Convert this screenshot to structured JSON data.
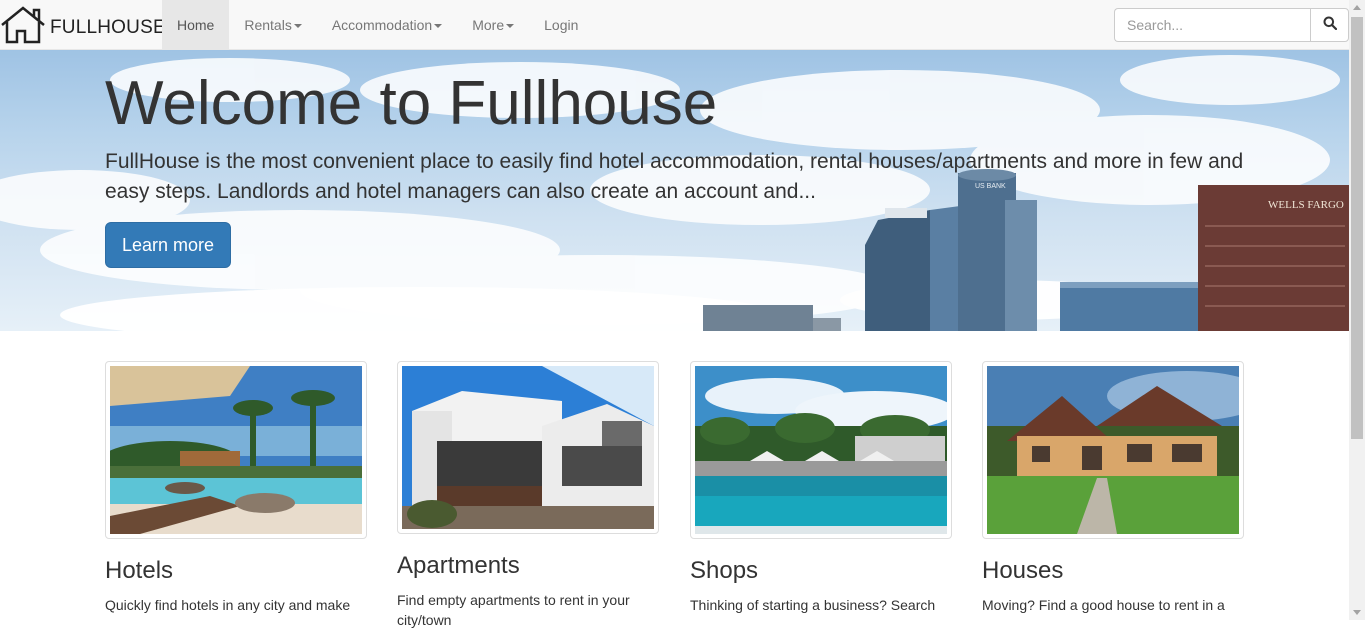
{
  "brand": {
    "name": "FULLHOUSE",
    "icon": "house-outline-icon"
  },
  "nav": {
    "items": [
      {
        "label": "Home",
        "active": true,
        "dropdown": false
      },
      {
        "label": "Rentals",
        "active": false,
        "dropdown": true
      },
      {
        "label": "Accommodation",
        "active": false,
        "dropdown": true
      },
      {
        "label": "More",
        "active": false,
        "dropdown": true
      },
      {
        "label": "Login",
        "active": false,
        "dropdown": false
      }
    ]
  },
  "search": {
    "placeholder": "Search...",
    "value": "",
    "icon": "search-icon"
  },
  "hero": {
    "title": "Welcome to Fullhouse",
    "text": "FullHouse is the most convenient place to easily find hotel accommodation, rental houses/apartments and more in few and easy steps. Landlords and hotel managers can also create an account and...",
    "button_label": "Learn more",
    "building_signs": [
      "WELLS FARGO",
      "US BANK"
    ]
  },
  "cards": [
    {
      "title": "Hotels",
      "text": "Quickly find hotels in any city and make"
    },
    {
      "title": "Apartments",
      "text": "Find empty apartments to rent in your city/town"
    },
    {
      "title": "Shops",
      "text": "Thinking of starting a business? Search"
    },
    {
      "title": "Houses",
      "text": "Moving? Find a good house to rent in a"
    }
  ],
  "colors": {
    "primary": "#337ab7",
    "navbar_bg": "#f8f8f8",
    "nav_active_bg": "#e7e7e7",
    "nav_text": "#777777"
  }
}
